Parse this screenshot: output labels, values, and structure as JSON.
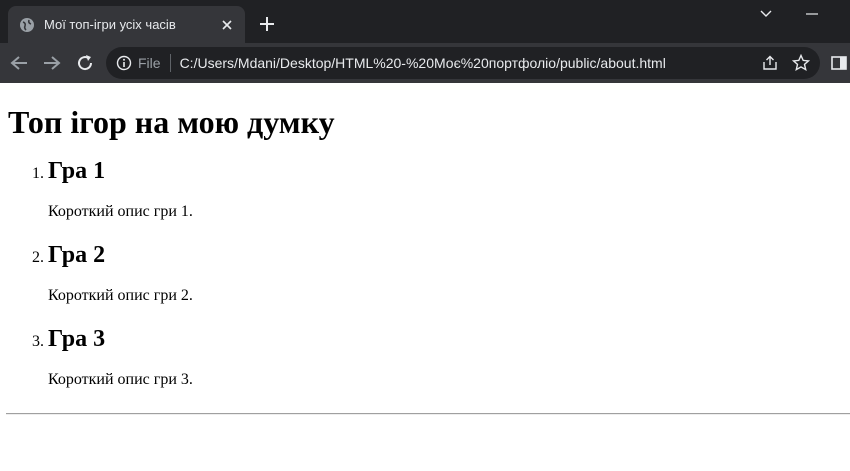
{
  "browser": {
    "tab_title": "Мої топ-ігри усіх часів",
    "scheme_label": "File",
    "url": "C:/Users/Mdani/Desktop/HTML%20-%20Моє%20портфоліо/public/about.html"
  },
  "page": {
    "heading": "Топ ігор на мою думку",
    "games": [
      {
        "number": "1.",
        "title": "Гра 1",
        "description": "Короткий опис гри 1."
      },
      {
        "number": "2.",
        "title": "Гра 2",
        "description": "Короткий опис гри 2."
      },
      {
        "number": "3.",
        "title": "Гра 3",
        "description": "Короткий опис гри 3."
      }
    ]
  }
}
